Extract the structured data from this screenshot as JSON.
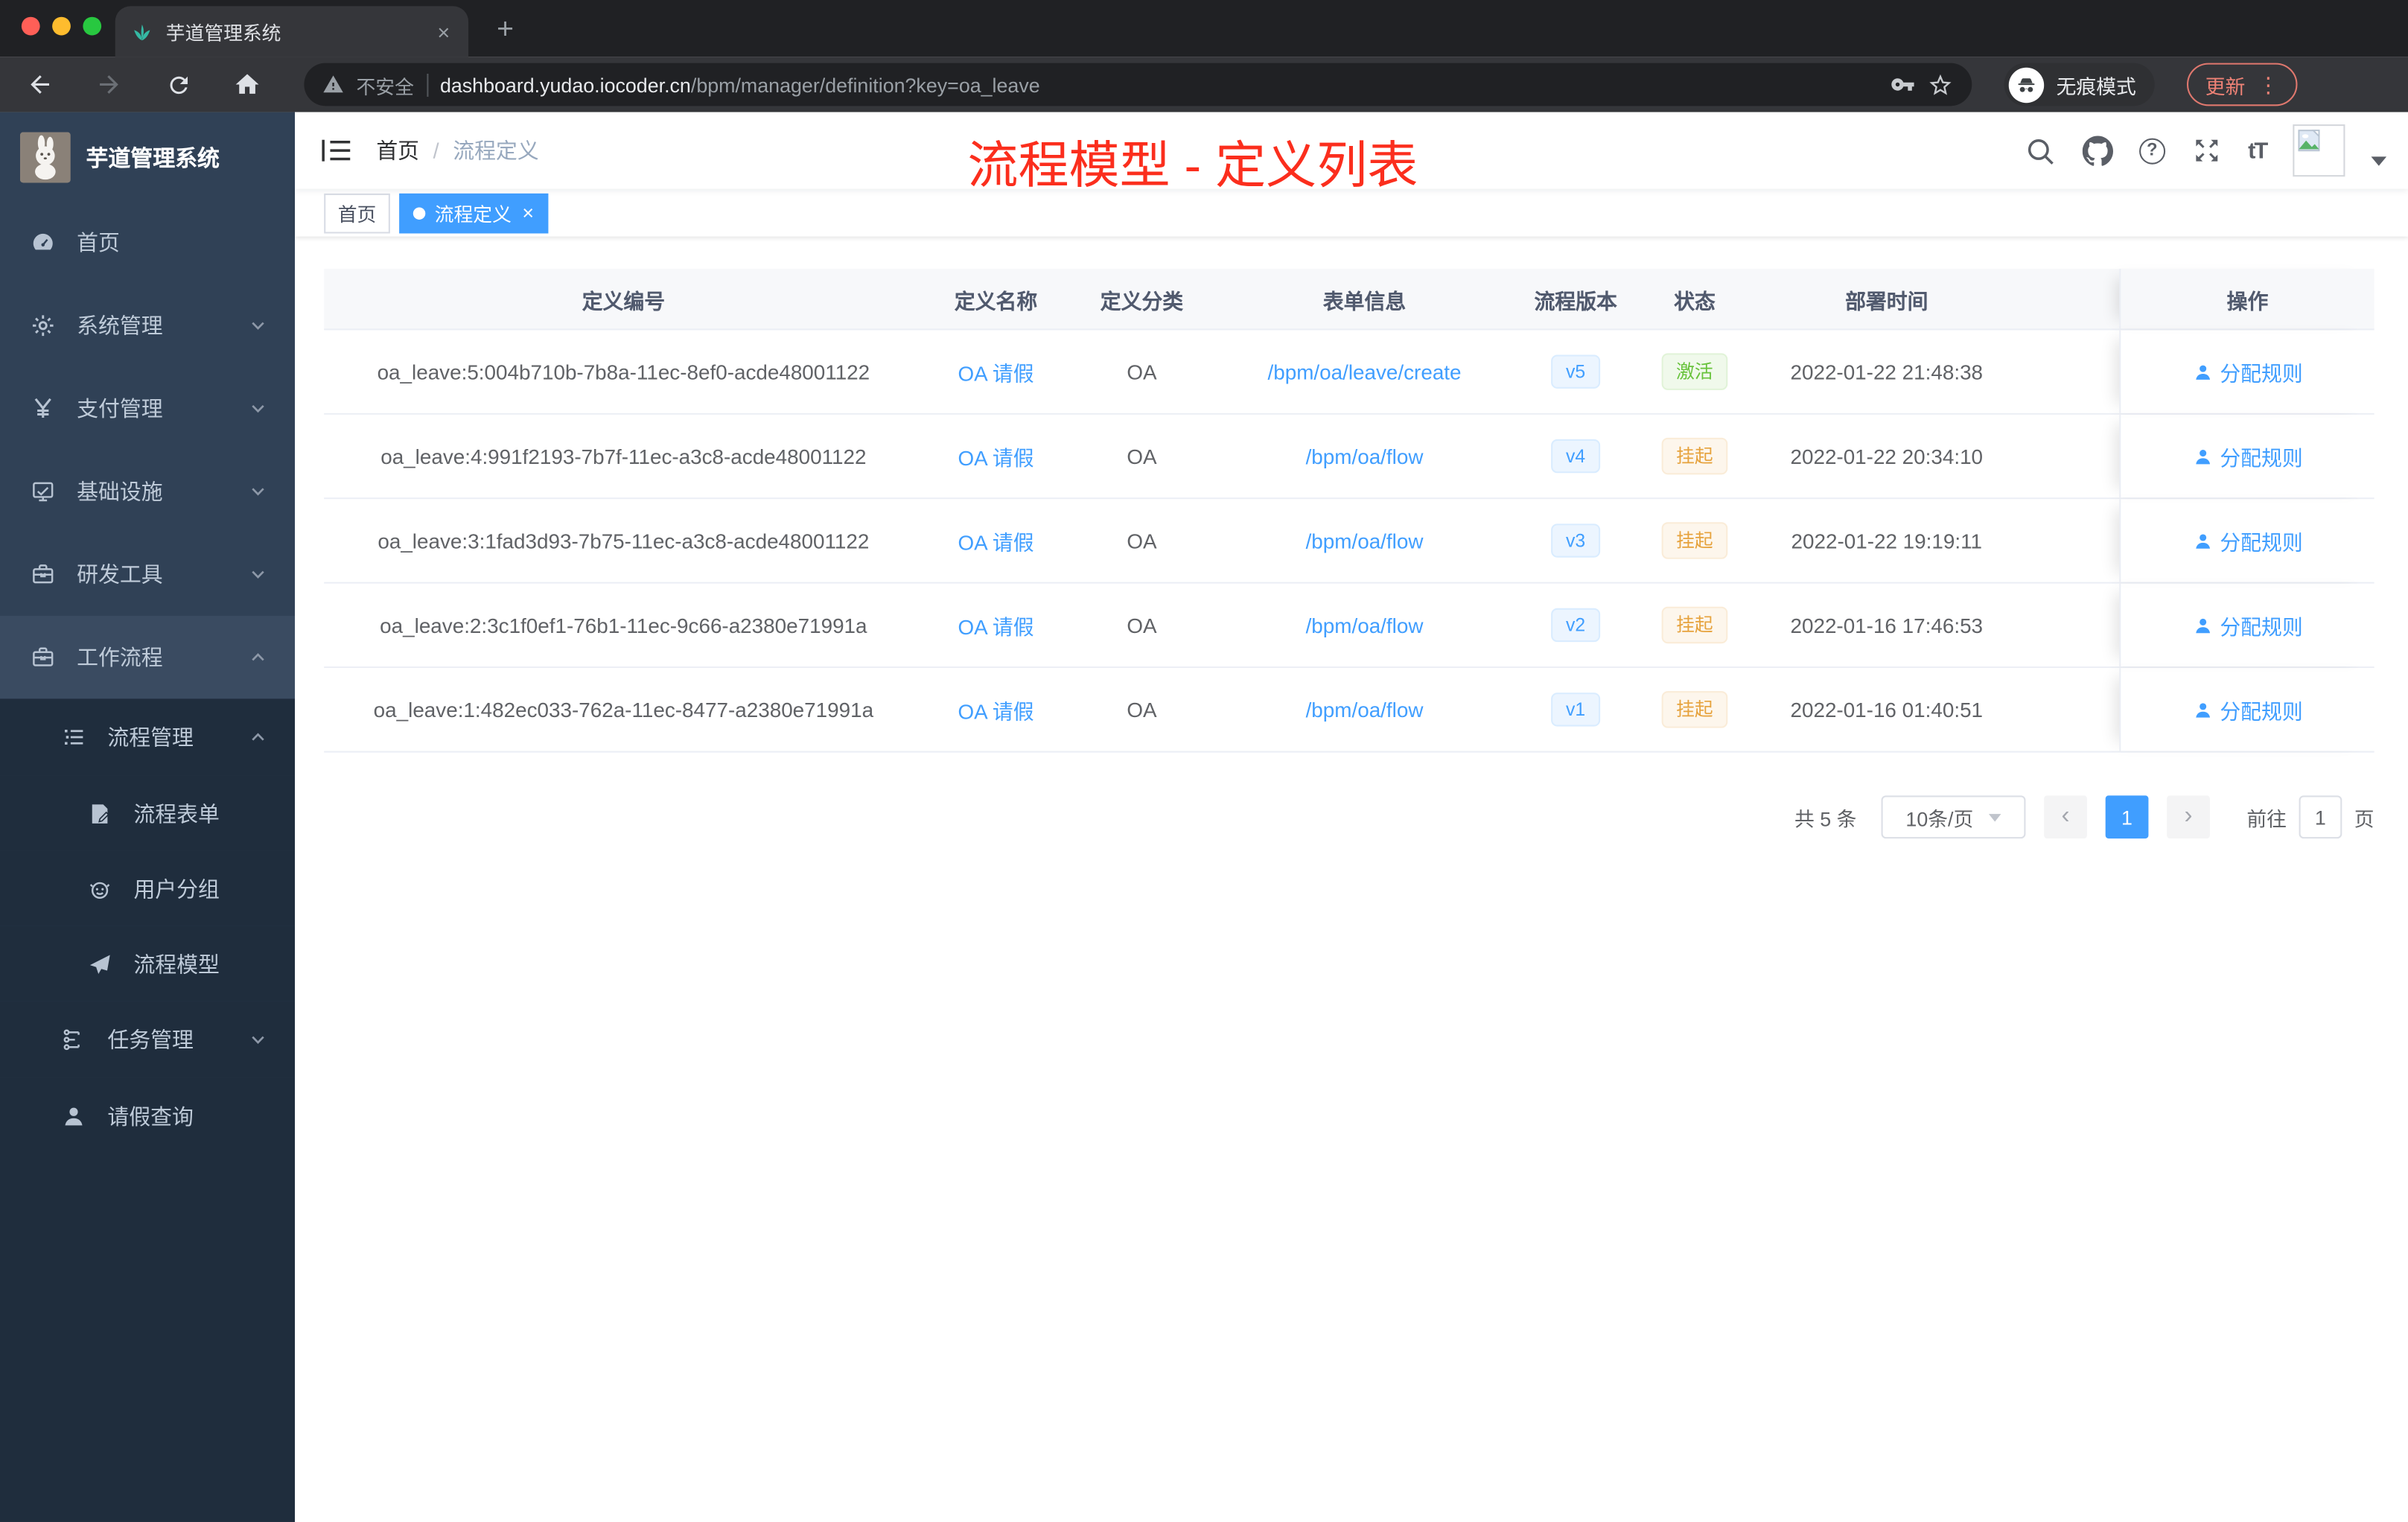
{
  "colors": {
    "accent": "#409eff",
    "success": "#67c23a",
    "warning": "#e6a23c",
    "annotation_red": "#fb2e1d",
    "sidebar_bg": "#304156",
    "sidebar_submenu_bg": "#1f2d3d",
    "active_tag_bg": "#409eff",
    "version_badge_bg": "#ecf5ff",
    "status_success_bg": "#f0f9eb",
    "status_warning_bg": "#fdf6ec"
  },
  "browser": {
    "tab": {
      "title": "芋道管理系统",
      "close_glyph": "×",
      "new_tab_glyph": "+"
    },
    "toolbar": {
      "security_label": "不安全",
      "url_host": "dashboard.yudao.iocoder.cn",
      "url_path": "/bpm/manager/definition?key=oa_leave",
      "incognito_label": "无痕模式",
      "update_label": "更新",
      "menu_glyph": "⋮"
    }
  },
  "sidebar": {
    "app_title": "芋道管理系统",
    "items": [
      {
        "icon": "gauge",
        "label": "首页",
        "level": 0,
        "chevron": "",
        "zone": "light"
      },
      {
        "icon": "gear",
        "label": "系统管理",
        "level": 0,
        "chevron": "down",
        "zone": "light"
      },
      {
        "icon": "yen",
        "label": "支付管理",
        "level": 0,
        "chevron": "down",
        "zone": "light"
      },
      {
        "icon": "monitor",
        "label": "基础设施",
        "level": 0,
        "chevron": "down",
        "zone": "light"
      },
      {
        "icon": "toolbox",
        "label": "研发工具",
        "level": 0,
        "chevron": "down",
        "zone": "light"
      },
      {
        "icon": "toolbox",
        "label": "工作流程",
        "level": 0,
        "chevron": "up",
        "zone": "light",
        "highlight": true
      },
      {
        "icon": "list",
        "label": "流程管理",
        "level": 1,
        "chevron": "up",
        "zone": "dark"
      },
      {
        "icon": "form",
        "label": "流程表单",
        "level": 2,
        "chevron": "",
        "zone": "dark"
      },
      {
        "icon": "robot",
        "label": "用户分组",
        "level": 2,
        "chevron": "",
        "zone": "dark"
      },
      {
        "icon": "paper-plane",
        "label": "流程模型",
        "level": 2,
        "chevron": "",
        "zone": "dark"
      },
      {
        "icon": "org-tree",
        "label": "任务管理",
        "level": 1,
        "chevron": "down",
        "zone": "dark"
      },
      {
        "icon": "user",
        "label": "请假查询",
        "level": 1,
        "chevron": "",
        "zone": "dark"
      }
    ]
  },
  "navbar": {
    "breadcrumb": {
      "home": "首页",
      "separator": "/",
      "current": "流程定义"
    },
    "help_glyph": "?",
    "font_size_glyph": "tT"
  },
  "annotation": "流程模型 - 定义列表",
  "tags": [
    {
      "label": "首页",
      "active": false
    },
    {
      "label": "流程定义",
      "active": true,
      "close_glyph": "×"
    }
  ],
  "table": {
    "columns": [
      "定义编号",
      "定义名称",
      "定义分类",
      "表单信息",
      "流程版本",
      "状态",
      "部署时间",
      "操作"
    ],
    "rows": [
      {
        "id": "oa_leave:5:004b710b-7b8a-11ec-8ef0-acde48001122",
        "name": "OA 请假",
        "category": "OA",
        "form": "/bpm/oa/leave/create",
        "version": "v5",
        "status": {
          "label": "激活",
          "type": "success"
        },
        "deploy_time": "2022-01-22 21:48:38",
        "action": "分配规则"
      },
      {
        "id": "oa_leave:4:991f2193-7b7f-11ec-a3c8-acde48001122",
        "name": "OA 请假",
        "category": "OA",
        "form": "/bpm/oa/flow",
        "version": "v4",
        "status": {
          "label": "挂起",
          "type": "warning"
        },
        "deploy_time": "2022-01-22 20:34:10",
        "action": "分配规则"
      },
      {
        "id": "oa_leave:3:1fad3d93-7b75-11ec-a3c8-acde48001122",
        "name": "OA 请假",
        "category": "OA",
        "form": "/bpm/oa/flow",
        "version": "v3",
        "status": {
          "label": "挂起",
          "type": "warning"
        },
        "deploy_time": "2022-01-22 19:19:11",
        "action": "分配规则"
      },
      {
        "id": "oa_leave:2:3c1f0ef1-76b1-11ec-9c66-a2380e71991a",
        "name": "OA 请假",
        "category": "OA",
        "form": "/bpm/oa/flow",
        "version": "v2",
        "status": {
          "label": "挂起",
          "type": "warning"
        },
        "deploy_time": "2022-01-16 17:46:53",
        "action": "分配规则"
      },
      {
        "id": "oa_leave:1:482ec033-762a-11ec-8477-a2380e71991a",
        "name": "OA 请假",
        "category": "OA",
        "form": "/bpm/oa/flow",
        "version": "v1",
        "status": {
          "label": "挂起",
          "type": "warning"
        },
        "deploy_time": "2022-01-16 01:40:51",
        "action": "分配规则"
      }
    ]
  },
  "pagination": {
    "total": "共 5 条",
    "page_size": "10条/页",
    "prev_glyph": "‹",
    "current_page": "1",
    "next_glyph": "›",
    "goto_label": "前往",
    "goto_value": "1",
    "page_unit": "页"
  }
}
